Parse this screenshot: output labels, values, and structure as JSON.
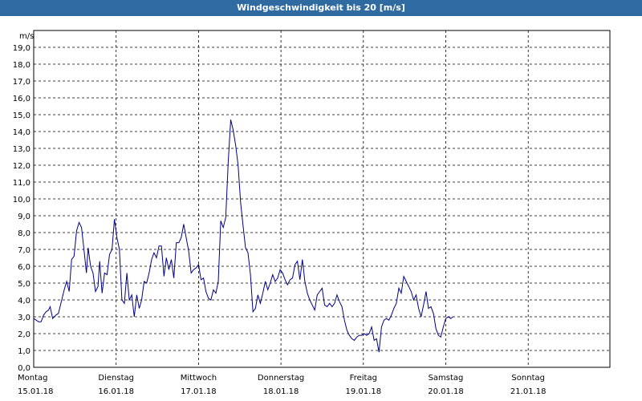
{
  "window": {
    "title": "Windgeschwindigkeit bis 20 [m/s]"
  },
  "chart_data": {
    "type": "line",
    "title": "Windgeschwindigkeit bis 20 [m/s]",
    "ylabel": "m/s",
    "ylim": [
      0,
      20
    ],
    "yticks": [
      "0,0",
      "1,0",
      "2,0",
      "3,0",
      "4,0",
      "5,0",
      "6,0",
      "7,0",
      "8,0",
      "9,0",
      "10,0",
      "11,0",
      "12,0",
      "13,0",
      "14,0",
      "15,0",
      "16,0",
      "17,0",
      "18,0",
      "19,0"
    ],
    "x_range_days": [
      0,
      7
    ],
    "x_ticks": [
      {
        "day": "Montag",
        "date": "15.01.18"
      },
      {
        "day": "Dienstag",
        "date": "16.01.18"
      },
      {
        "day": "Mittwoch",
        "date": "17.01.18"
      },
      {
        "day": "Donnerstag",
        "date": "18.01.18"
      },
      {
        "day": "Freitag",
        "date": "19.01.18"
      },
      {
        "day": "Samstag",
        "date": "20.01.18"
      },
      {
        "day": "Sonntag",
        "date": "21.01.18"
      }
    ],
    "grid": true,
    "colors": {
      "line": "#00008b",
      "grid": "#000000",
      "frame": "#000000",
      "titlebar": "#2f6aa0"
    },
    "series": [
      {
        "values": [
          [
            0.0,
            2.9
          ],
          [
            0.03,
            2.8
          ],
          [
            0.06,
            2.7
          ],
          [
            0.09,
            2.7
          ],
          [
            0.12,
            3.1
          ],
          [
            0.15,
            3.3
          ],
          [
            0.18,
            3.4
          ],
          [
            0.2,
            3.6
          ],
          [
            0.23,
            2.9
          ],
          [
            0.27,
            3.1
          ],
          [
            0.3,
            3.2
          ],
          [
            0.33,
            3.8
          ],
          [
            0.37,
            4.6
          ],
          [
            0.4,
            5.1
          ],
          [
            0.43,
            4.5
          ],
          [
            0.46,
            6.4
          ],
          [
            0.49,
            6.6
          ],
          [
            0.52,
            8.1
          ],
          [
            0.55,
            8.6
          ],
          [
            0.58,
            8.3
          ],
          [
            0.61,
            7.0
          ],
          [
            0.64,
            5.6
          ],
          [
            0.66,
            7.1
          ],
          [
            0.69,
            6.0
          ],
          [
            0.72,
            5.6
          ],
          [
            0.75,
            4.5
          ],
          [
            0.78,
            4.8
          ],
          [
            0.8,
            6.3
          ],
          [
            0.83,
            4.4
          ],
          [
            0.86,
            5.6
          ],
          [
            0.89,
            5.5
          ],
          [
            0.92,
            6.7
          ],
          [
            0.95,
            7.0
          ],
          [
            0.98,
            8.8
          ],
          [
            1.01,
            7.7
          ],
          [
            1.04,
            7.0
          ],
          [
            1.07,
            4.0
          ],
          [
            1.1,
            3.8
          ],
          [
            1.13,
            5.6
          ],
          [
            1.16,
            4.0
          ],
          [
            1.19,
            4.3
          ],
          [
            1.22,
            3.0
          ],
          [
            1.25,
            4.3
          ],
          [
            1.28,
            3.5
          ],
          [
            1.31,
            4.0
          ],
          [
            1.34,
            5.1
          ],
          [
            1.37,
            5.0
          ],
          [
            1.4,
            5.6
          ],
          [
            1.43,
            6.4
          ],
          [
            1.46,
            6.8
          ],
          [
            1.49,
            6.5
          ],
          [
            1.52,
            7.2
          ],
          [
            1.55,
            7.2
          ],
          [
            1.58,
            5.4
          ],
          [
            1.61,
            6.5
          ],
          [
            1.64,
            5.8
          ],
          [
            1.67,
            6.4
          ],
          [
            1.7,
            5.3
          ],
          [
            1.73,
            7.4
          ],
          [
            1.76,
            7.4
          ],
          [
            1.79,
            7.7
          ],
          [
            1.82,
            8.5
          ],
          [
            1.85,
            7.7
          ],
          [
            1.88,
            6.9
          ],
          [
            1.91,
            5.6
          ],
          [
            1.94,
            5.8
          ],
          [
            1.97,
            5.9
          ],
          [
            2.0,
            6.1
          ],
          [
            2.03,
            5.2
          ],
          [
            2.06,
            5.3
          ],
          [
            2.09,
            4.5
          ],
          [
            2.12,
            4.1
          ],
          [
            2.15,
            4.0
          ],
          [
            2.18,
            4.6
          ],
          [
            2.21,
            4.4
          ],
          [
            2.24,
            5.1
          ],
          [
            2.27,
            8.7
          ],
          [
            2.3,
            8.3
          ],
          [
            2.33,
            8.9
          ],
          [
            2.36,
            12.2
          ],
          [
            2.39,
            14.7
          ],
          [
            2.42,
            14.1
          ],
          [
            2.45,
            13.2
          ],
          [
            2.48,
            12.0
          ],
          [
            2.51,
            9.8
          ],
          [
            2.54,
            8.4
          ],
          [
            2.57,
            7.1
          ],
          [
            2.6,
            6.8
          ],
          [
            2.63,
            5.5
          ],
          [
            2.66,
            3.3
          ],
          [
            2.69,
            3.5
          ],
          [
            2.72,
            4.3
          ],
          [
            2.75,
            3.8
          ],
          [
            2.78,
            4.4
          ],
          [
            2.81,
            5.1
          ],
          [
            2.84,
            4.6
          ],
          [
            2.87,
            5.0
          ],
          [
            2.9,
            5.5
          ],
          [
            2.93,
            5.1
          ],
          [
            2.96,
            5.3
          ],
          [
            2.99,
            5.8
          ],
          [
            3.02,
            5.6
          ],
          [
            3.05,
            5.2
          ],
          [
            3.08,
            4.9
          ],
          [
            3.11,
            5.2
          ],
          [
            3.14,
            5.3
          ],
          [
            3.17,
            6.1
          ],
          [
            3.2,
            6.3
          ],
          [
            3.23,
            5.2
          ],
          [
            3.26,
            6.4
          ],
          [
            3.29,
            5.1
          ],
          [
            3.32,
            4.4
          ],
          [
            3.35,
            4.0
          ],
          [
            3.38,
            3.7
          ],
          [
            3.41,
            3.4
          ],
          [
            3.44,
            4.3
          ],
          [
            3.47,
            4.5
          ],
          [
            3.5,
            4.7
          ],
          [
            3.53,
            3.7
          ],
          [
            3.56,
            3.6
          ],
          [
            3.59,
            3.8
          ],
          [
            3.62,
            3.6
          ],
          [
            3.65,
            3.8
          ],
          [
            3.68,
            4.3
          ],
          [
            3.71,
            3.9
          ],
          [
            3.74,
            3.6
          ],
          [
            3.77,
            2.8
          ],
          [
            3.8,
            2.2
          ],
          [
            3.83,
            1.9
          ],
          [
            3.86,
            1.7
          ],
          [
            3.89,
            1.6
          ],
          [
            3.92,
            1.8
          ],
          [
            3.95,
            1.9
          ],
          [
            3.98,
            1.9
          ],
          [
            4.01,
            2.0
          ],
          [
            4.04,
            1.9
          ],
          [
            4.07,
            2.0
          ],
          [
            4.1,
            2.4
          ],
          [
            4.13,
            1.6
          ],
          [
            4.16,
            1.7
          ],
          [
            4.19,
            0.9
          ],
          [
            4.22,
            2.4
          ],
          [
            4.25,
            2.8
          ],
          [
            4.28,
            2.9
          ],
          [
            4.31,
            2.8
          ],
          [
            4.34,
            3.1
          ],
          [
            4.37,
            3.5
          ],
          [
            4.4,
            3.8
          ],
          [
            4.43,
            4.7
          ],
          [
            4.46,
            4.4
          ],
          [
            4.49,
            5.4
          ],
          [
            4.52,
            5.1
          ],
          [
            4.55,
            4.8
          ],
          [
            4.58,
            4.5
          ],
          [
            4.61,
            4.0
          ],
          [
            4.64,
            4.3
          ],
          [
            4.67,
            3.5
          ],
          [
            4.7,
            3.0
          ],
          [
            4.73,
            3.7
          ],
          [
            4.76,
            4.5
          ],
          [
            4.79,
            3.5
          ],
          [
            4.82,
            3.6
          ],
          [
            4.85,
            3.2
          ],
          [
            4.88,
            2.3
          ],
          [
            4.91,
            1.9
          ],
          [
            4.94,
            1.8
          ],
          [
            4.97,
            2.4
          ],
          [
            5.0,
            2.9
          ],
          [
            5.03,
            3.0
          ],
          [
            5.06,
            2.9
          ],
          [
            5.09,
            3.0
          ]
        ]
      }
    ]
  }
}
